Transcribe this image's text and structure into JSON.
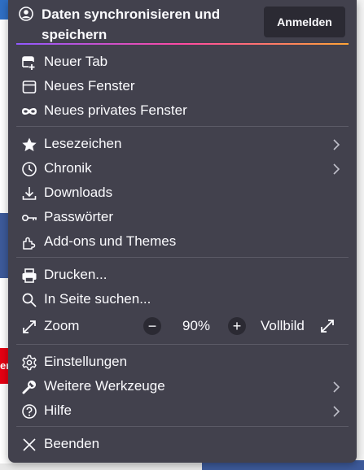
{
  "background": {
    "red_fragment_text": "er"
  },
  "header": {
    "title": "Daten synchronisieren und speichern",
    "signin_label": "Anmelden"
  },
  "menu": {
    "new_tab": "Neuer Tab",
    "new_window": "Neues Fenster",
    "new_private_window": "Neues privates Fenster",
    "bookmarks": "Lesezeichen",
    "history": "Chronik",
    "downloads": "Downloads",
    "passwords": "Passwörter",
    "addons": "Add-ons und Themes",
    "print": "Drucken...",
    "find": "In Seite suchen...",
    "zoom": "Zoom",
    "zoom_minus": "−",
    "zoom_value": "90%",
    "zoom_plus": "+",
    "fullscreen": "Vollbild",
    "settings": "Einstellungen",
    "more_tools": "Weitere Werkzeuge",
    "help": "Hilfe",
    "quit": "Beenden"
  },
  "colors": {
    "menu_bg": "#42414d",
    "text": "#fbfbfe",
    "button_bg": "#2b2a33",
    "separator": "#5b5a66"
  }
}
